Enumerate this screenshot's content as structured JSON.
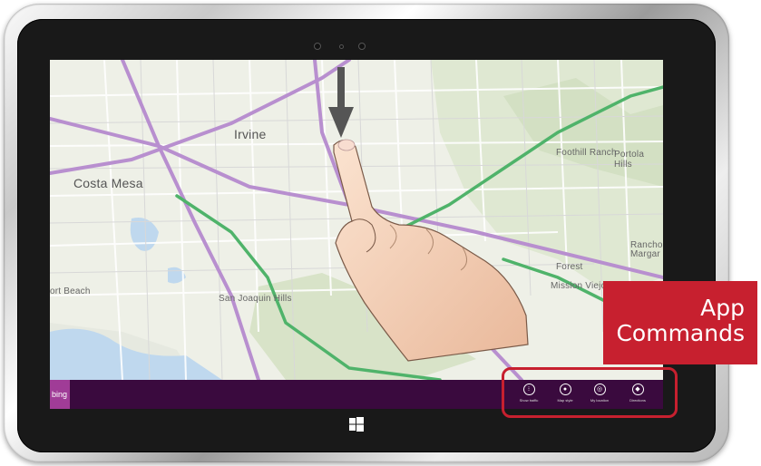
{
  "map": {
    "places": {
      "irvine": "Irvine",
      "costa_mesa": "Costa Mesa",
      "foothill_ranch": "Foothill Ranch",
      "portola_hills": "Portola Hills",
      "lake_forest": "Forest",
      "mission_viejo": "Mission Viejo",
      "rancho_santa_margarita": "Rancho Sa\nMargar",
      "san_joaquin_hills": "San Joaquin Hills",
      "newport_beach": "ort Beach"
    }
  },
  "app_bar": {
    "logo_text": "bing",
    "commands": [
      {
        "label": "Show traffic",
        "icon": "traffic-icon"
      },
      {
        "label": "Map style",
        "icon": "map-style-icon"
      },
      {
        "label": "My location",
        "icon": "location-icon"
      },
      {
        "label": "Directions",
        "icon": "directions-icon"
      }
    ]
  },
  "callout": {
    "line1": "App",
    "line2": "Commands",
    "color": "#c7202f"
  },
  "colors": {
    "app_bar_bg": "#3a0a3e",
    "highway": "#b88fcf",
    "green_road": "#4fb36a"
  }
}
